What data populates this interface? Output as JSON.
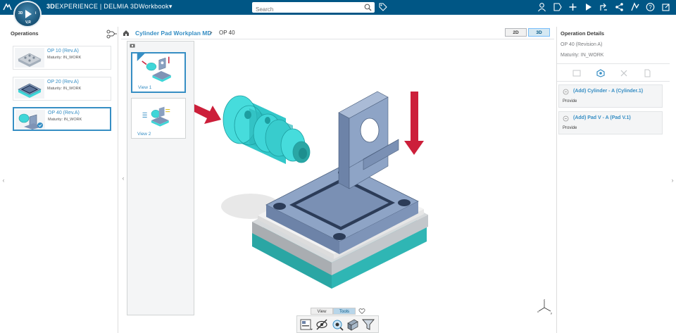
{
  "topbar": {
    "brand_bold": "3D",
    "brand_rest": "EXPERIENCE | DELMIA",
    "app_name": "3DWorkbook",
    "search_placeholder": "Search",
    "compass": {
      "left": "3D",
      "right": "i",
      "bottom": "V,R"
    }
  },
  "left_panel": {
    "title": "Operations",
    "operations": [
      {
        "name": "OP 10  (Rev.A)",
        "maturity": "Maturity: IN_WORK"
      },
      {
        "name": "OP 20  (Rev.A)",
        "maturity": "Maturity: IN_WORK"
      },
      {
        "name": "OP 40  (Rev.A)",
        "maturity": "Maturity: IN_WORK",
        "selected": true
      }
    ]
  },
  "breadcrumb": {
    "plan": "Cylinder Pad Workplan MD",
    "separator": ">",
    "current": "OP 40"
  },
  "mode_toggle": {
    "two_d": "2D",
    "three_d": "3D",
    "active": "3D"
  },
  "views": [
    {
      "label": "View 1",
      "selected": true
    },
    {
      "label": "View 2"
    }
  ],
  "bottom_tabs": {
    "view": "View",
    "tools": "Tools",
    "active": "Tools"
  },
  "right_panel": {
    "title": "Operation Details",
    "revision": "OP 40 (Revision A)",
    "maturity": "Maturity: IN_WORK",
    "items": [
      {
        "name": "(Add) Cylinder - A (Cylinder.1)",
        "value": "Provide"
      },
      {
        "name": "(Add) Pad V - A (Pad V.1)",
        "value": "Provide"
      }
    ]
  },
  "colors": {
    "topbar": "#005685",
    "accent": "#368ec4",
    "part_cyan": "#3fd6d8",
    "part_blue": "#7a94b8",
    "arrow_red": "#cc1f3a"
  }
}
